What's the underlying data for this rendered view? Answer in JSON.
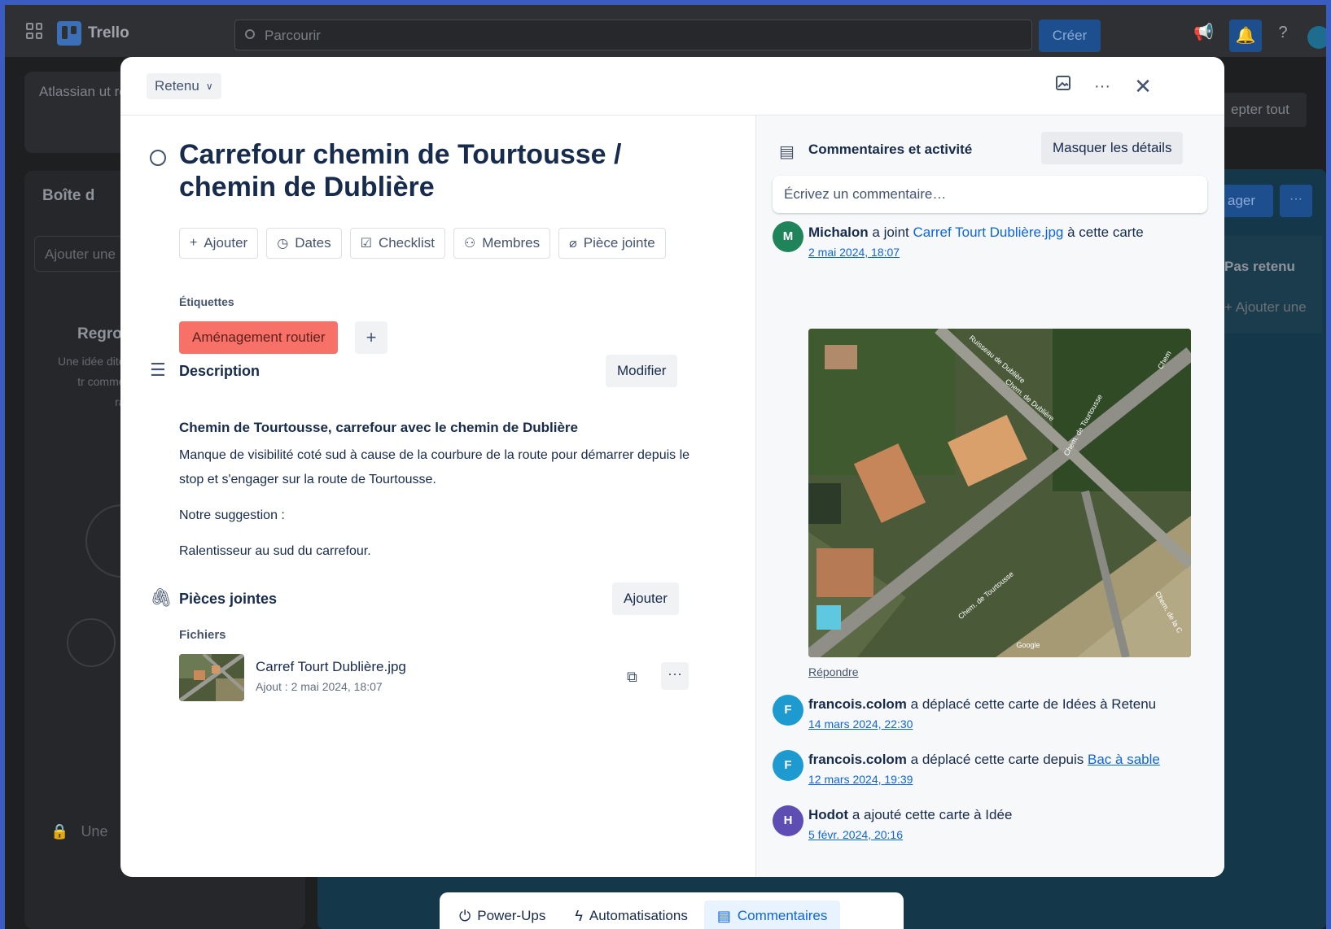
{
  "app": {
    "name": "Trello",
    "search_placeholder": "Parcourir",
    "create_label": "Créer"
  },
  "background": {
    "banner_text": "Atlassian ut recherches votre appar",
    "accept_label": "epter tout",
    "inbox_title": "Boîte d",
    "inbox_add": "Ajouter une",
    "regroup_title": "Regro",
    "regroup_text": "Une idée dites-la, tr comment el rapide",
    "lock_text": "Une",
    "share_label": "ager",
    "column_title": "Pas retenu",
    "column_add": "Ajouter une"
  },
  "card": {
    "list_name": "Retenu",
    "title": "Carrefour chemin de Tourtousse / chemin de Dublière",
    "actions": [
      {
        "icon": "plus-icon",
        "glyph": "+",
        "label": "Ajouter"
      },
      {
        "icon": "clock-icon",
        "glyph": "◷",
        "label": "Dates"
      },
      {
        "icon": "checklist-icon",
        "glyph": "☑",
        "label": "Checklist"
      },
      {
        "icon": "add-member-icon",
        "glyph": "⚇",
        "label": "Membres"
      },
      {
        "icon": "paperclip-icon",
        "glyph": "⌀",
        "label": "Pièce jointe"
      }
    ],
    "labels_title": "Étiquettes",
    "labels": [
      {
        "text": "Aménagement routier",
        "color": "#f87168"
      }
    ],
    "description": {
      "title": "Description",
      "edit_label": "Modifier",
      "heading": "Chemin de Tourtousse, carrefour avec le chemin de Dublière",
      "paragraph1": "Manque de visibilité coté sud à cause de la courbure de la route pour démarrer depuis le stop et s'engager sur la route  de Tourtousse.",
      "paragraph2": "Notre suggestion :",
      "paragraph3": "Ralentisseur au sud du carrefour."
    },
    "attachments": {
      "title": "Pièces jointes",
      "add_label": "Ajouter",
      "files_title": "Fichiers",
      "file_name": "Carref Tourt Dublière.jpg",
      "file_meta": "Ajout : 2 mai 2024, 18:07"
    }
  },
  "activity": {
    "title": "Commentaires et activité",
    "hide_label": "Masquer les détails",
    "comment_placeholder": "Écrivez un commentaire…",
    "reply_label": "Répondre",
    "items": [
      {
        "avatar": "M",
        "color": "#1f845a",
        "user": "Michalon",
        "text1": " a joint ",
        "link": "Carref Tourt Dublière.jpg",
        "text2": " à cette carte",
        "date": "2 mai 2024, 18:07"
      },
      {
        "avatar": "F",
        "color": "#1d9bd1",
        "user": "francois.colom",
        "text1": " a déplacé cette carte de Idées à Retenu",
        "date": "14 mars 2024, 22:30"
      },
      {
        "avatar": "F",
        "color": "#1d9bd1",
        "user": "francois.colom",
        "text1": " a déplacé cette carte depuis ",
        "link": "Bac à sable",
        "date": "12 mars 2024, 19:39"
      },
      {
        "avatar": "H",
        "color": "#5e4db2",
        "user": "Hodot",
        "text1": " a ajouté cette carte à Idée",
        "date": "5 févr. 2024, 20:16"
      }
    ]
  },
  "bottom_bar": {
    "items": [
      {
        "icon": "plug-icon",
        "glyph": "⏻",
        "label": "Power-Ups"
      },
      {
        "icon": "bolt-icon",
        "glyph": "ϟ",
        "label": "Automatisations"
      },
      {
        "icon": "comment-icon",
        "glyph": "▤",
        "label": "Commentaires"
      }
    ]
  },
  "map_labels": [
    "Ruisseau de Dublière",
    "Chem. de Dublière",
    "Chem. de Tourtousse",
    "Chem. de Tourtousse",
    "Chem. de la C",
    "Chem",
    "Google"
  ]
}
